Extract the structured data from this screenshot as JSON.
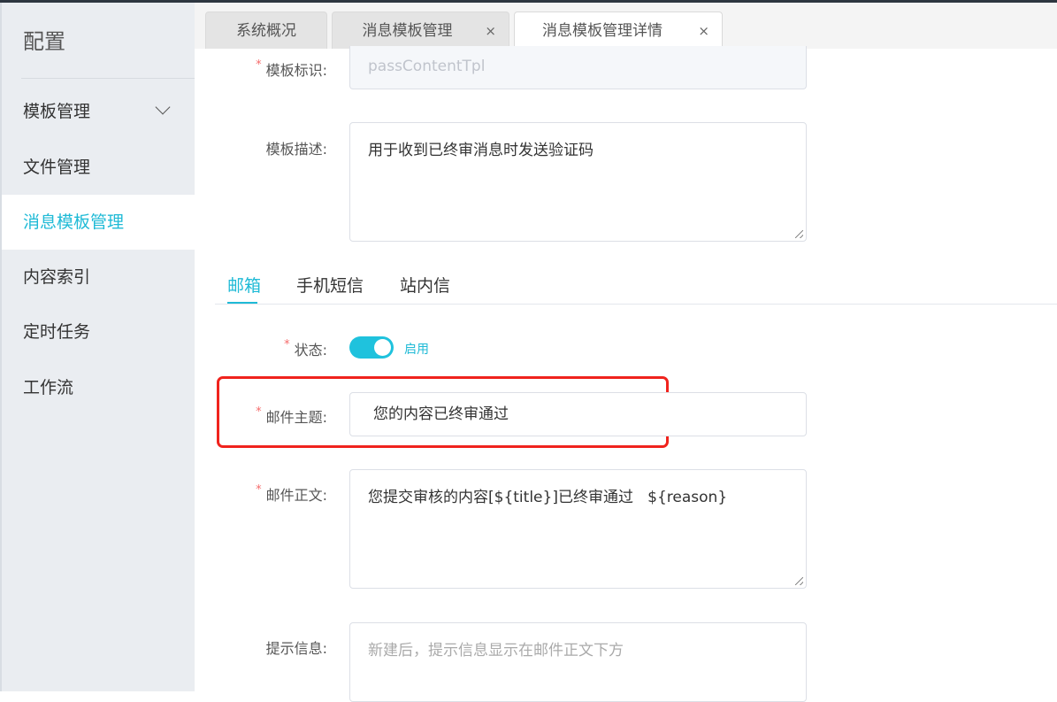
{
  "sidebar": {
    "title": "配置",
    "items": [
      {
        "label": "模板管理"
      },
      {
        "label": "文件管理"
      },
      {
        "label": "消息模板管理"
      },
      {
        "label": "内容索引"
      },
      {
        "label": "定时任务"
      },
      {
        "label": "工作流"
      }
    ],
    "active": "消息模板管理"
  },
  "tabs": [
    {
      "label": "系统概况"
    },
    {
      "label": "消息模板管理",
      "close": "×"
    },
    {
      "label": "消息模板管理详情",
      "close": "×"
    }
  ],
  "form": {
    "template_id": {
      "label": "模板标识:",
      "value": "passContentTpl"
    },
    "template_desc": {
      "label": "模板描述:",
      "value": "用于收到已终审消息时发送验证码"
    },
    "channel_tabs": [
      "邮箱",
      "手机短信",
      "站内信"
    ],
    "status": {
      "label": "状态:",
      "value": "启用",
      "on": true
    },
    "mail_subject": {
      "label": "邮件主题:",
      "value": "您的内容已终审通过"
    },
    "mail_body": {
      "label": "邮件正文:",
      "value": "您提交审核的内容[${title}]已终审通过   ${reason}"
    },
    "hint": {
      "label": "提示信息:",
      "placeholder": "新建后，提示信息显示在邮件正文下方"
    },
    "required_mark": "*"
  },
  "colors": {
    "accent": "#1fbad6",
    "required": "#f56c6c",
    "highlight_box": "#f0231d"
  }
}
